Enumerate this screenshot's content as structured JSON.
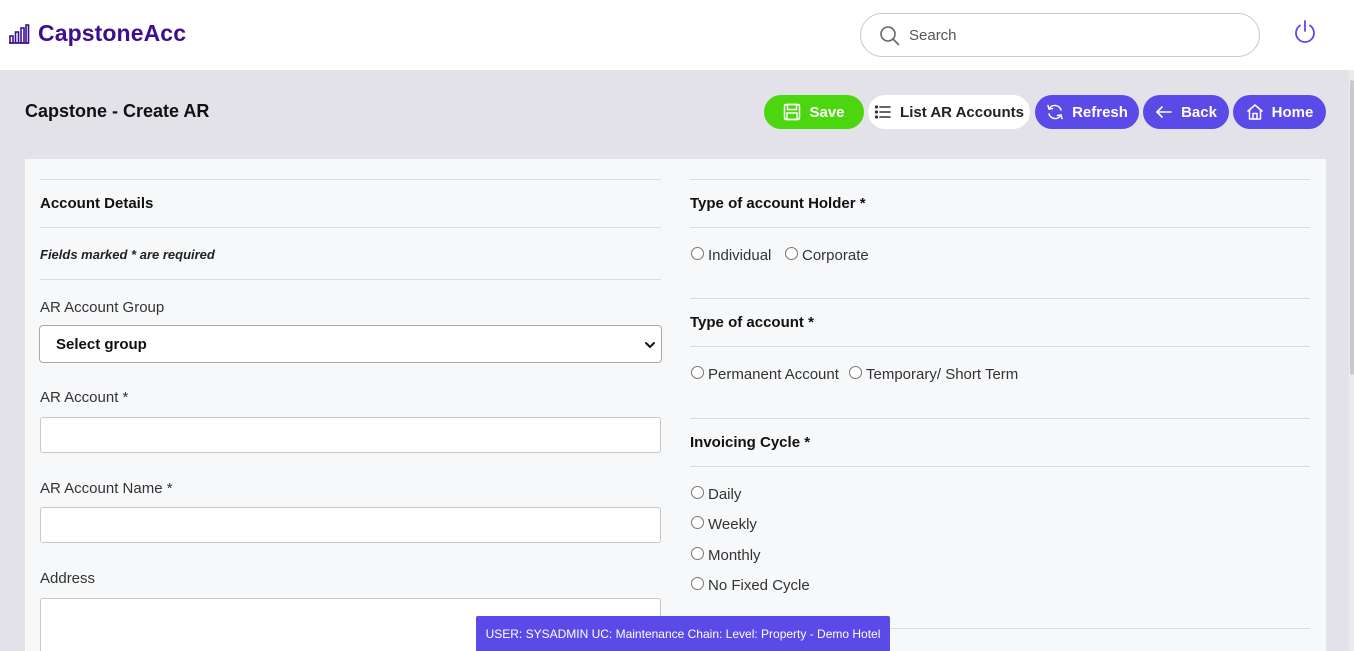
{
  "app": {
    "brand_name": "CapstoneAcc",
    "brand_icon": "bar-chart-icon",
    "accent_color": "#3d0f8f"
  },
  "search": {
    "placeholder": "Search"
  },
  "page": {
    "title": "Capstone - Create AR"
  },
  "toolbar": {
    "save_label": "Save",
    "list_label": "List AR Accounts",
    "refresh_label": "Refresh",
    "back_label": "Back",
    "home_label": "Home",
    "save_color": "#4cd610",
    "primary_color": "#5a4ae8"
  },
  "left_panel": {
    "section_title": "Account Details",
    "required_note": "Fields marked * are required",
    "group_label": "AR Account Group",
    "group_select_value": "Select group",
    "account_label": "AR Account *",
    "account_value": "",
    "account_name_label": "AR Account Name *",
    "account_name_value": "",
    "address_label": "Address",
    "address_value": ""
  },
  "right_panel": {
    "holder_title": "Type of account Holder *",
    "holder_options": [
      "Individual",
      "Corporate"
    ],
    "type_title": "Type of account *",
    "type_options": [
      "Permanent Account",
      "Temporary/ Short Term"
    ],
    "cycle_title": "Invoicing Cycle *",
    "cycle_options": [
      "Daily",
      "Weekly",
      "Monthly",
      "No Fixed Cycle"
    ]
  },
  "status_bar": {
    "text": "USER: SYSADMIN UC: Maintenance Chain: Level: Property - Demo Hotel"
  }
}
